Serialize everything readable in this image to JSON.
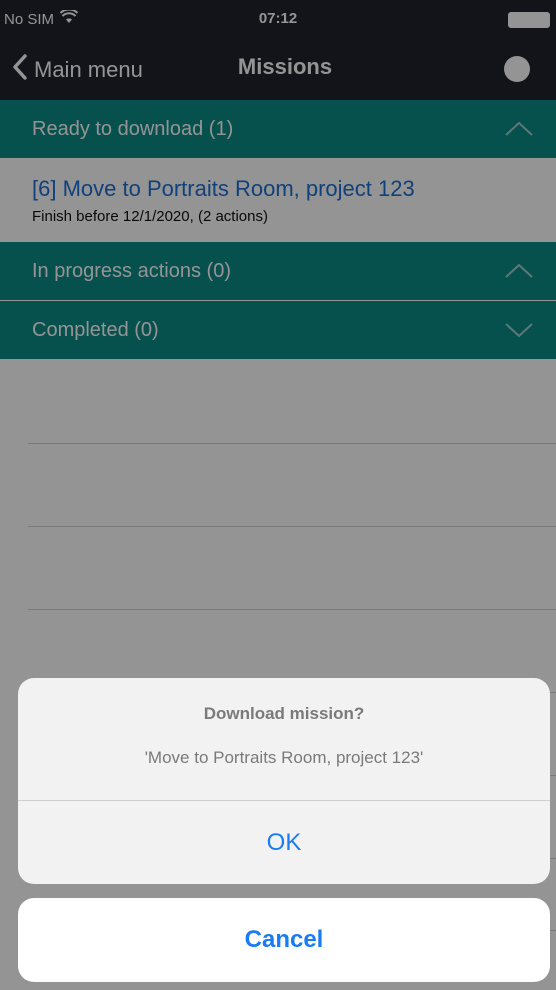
{
  "status_bar": {
    "carrier": "No SIM",
    "time": "07:12"
  },
  "nav": {
    "back_label": "Main menu",
    "title": "Missions"
  },
  "sections": [
    {
      "label": "Ready to download (1)",
      "expanded": true
    },
    {
      "label": "In progress actions (0)",
      "expanded": true
    },
    {
      "label": "Completed (0)",
      "expanded": false
    }
  ],
  "mission": {
    "title": "[6] Move to Portraits Room, project 123",
    "subtitle": "Finish before 12/1/2020, (2 actions)"
  },
  "dialog": {
    "title": "Download mission?",
    "message": "'Move to Portraits Room, project 123'",
    "ok_label": "OK",
    "cancel_label": "Cancel"
  },
  "colors": {
    "bar": "#20242b",
    "section": "#0b8a86",
    "link": "#1f6fd3",
    "action": "#1a7cf2"
  }
}
